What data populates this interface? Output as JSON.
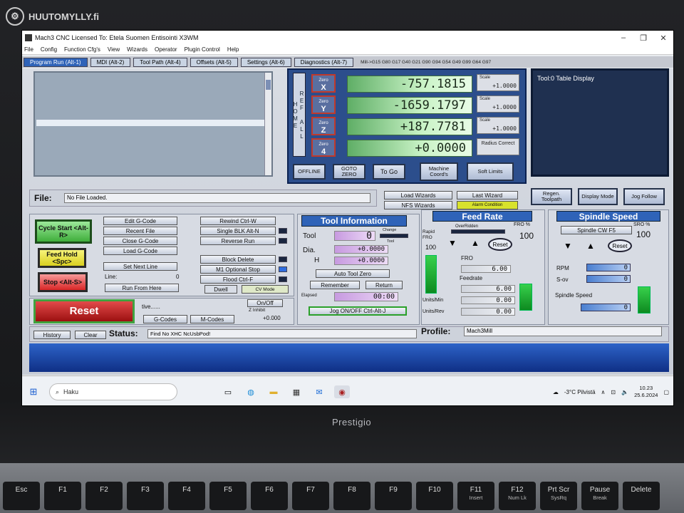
{
  "watermark": "HUUTOMYLLY.fi",
  "window": {
    "title": "Mach3 CNC  Licensed To: Etela Suomen Entisointi X3WM"
  },
  "menu": [
    "File",
    "Config",
    "Function Cfg's",
    "View",
    "Wizards",
    "Operator",
    "Plugin Control",
    "Help"
  ],
  "tabs": [
    "Program Run (Alt-1)",
    "MDI (Alt-2)",
    "Tool Path (Alt-4)",
    "Offsets (Alt-5)",
    "Settings (Alt-6)",
    "Diagnostics (Alt-7)"
  ],
  "active_gcodes": "Mill->G15  G80 G17 G40 G21 G90 G94 G54 G49 G99 G64 G97",
  "dro": {
    "ref_all_home": "REF ALL HOME",
    "axes": [
      {
        "zero_label": "Zero",
        "axis": "X",
        "value": "-757.1815",
        "scale_label": "Scale",
        "scale": "+1.0000"
      },
      {
        "zero_label": "Zero",
        "axis": "Y",
        "value": "-1659.1797",
        "scale_label": "Scale",
        "scale": "+1.0000"
      },
      {
        "zero_label": "Zero",
        "axis": "Z",
        "value": "+187.7781",
        "scale_label": "Scale",
        "scale": "+1.0000"
      },
      {
        "zero_label": "Zero",
        "axis": "4",
        "value": "+0.0000",
        "radius_label": "Radius Correct"
      }
    ],
    "buttons": [
      "OFFLINE",
      "GOTO ZERO",
      "To Go",
      "Machine Coord's",
      "Soft Limits"
    ]
  },
  "tool_display": {
    "label": "Tool:0   Table Display"
  },
  "file": {
    "label": "File:",
    "value": "No File Loaded."
  },
  "wizards": {
    "load": "Load Wizards",
    "last": "Last Wizard",
    "nfs": "NFS Wizards",
    "alarm": "Alarm Condition"
  },
  "view_buttons": [
    "Regen. Toolpath",
    "Display Mode",
    "Jog Follow"
  ],
  "program": {
    "cycle_start": "Cycle Start <Alt-R>",
    "feed_hold": "Feed Hold <Spc>",
    "stop": "Stop <Alt-S>",
    "reset": "Reset",
    "edit": "Edit G-Code",
    "recent": "Recent File",
    "close": "Close G-Code",
    "load": "Load G-Code",
    "set_next": "Set Next Line",
    "line_label": "Line:",
    "line_value": "0",
    "run_from": "Run From Here",
    "rewind": "Rewind Ctrl-W",
    "single_blk": "Single BLK Alt-N",
    "reverse": "Reverse Run",
    "block_delete": "Block Delete",
    "m1_stop": "M1 Optional Stop",
    "flood": "Flood Ctrl-F",
    "dwell": "Dwell",
    "cv_mode": "CV Mode",
    "tive": "tive......",
    "onoff": "On/Off",
    "z_inhibit": "Z Inhibit",
    "z_value": "+0.000",
    "gcodes_btn": "G-Codes",
    "mcodes_btn": "M-Codes"
  },
  "tool_info": {
    "title": "Tool Information",
    "tool_label": "Tool",
    "tool_value": "0",
    "change_label": "Change",
    "tool_small": "Tool",
    "dia_label": "Dia.",
    "dia_value": "+0.0000",
    "h_label": "H",
    "h_value": "+0.0000",
    "auto_zero": "Auto Tool Zero",
    "remember": "Remember",
    "return": "Return",
    "elapsed_label": "Elapsed",
    "elapsed_value": "00:00",
    "jog": "Jog ON/OFF Ctrl-Alt-J"
  },
  "feed": {
    "title": "Feed Rate",
    "overridden": "OverRidden",
    "fro_pct_label": "FRO %",
    "fro_pct": "100",
    "rapid_label": "Rapid FRO",
    "rapid_value": "100",
    "reset": "Reset",
    "fro_label": "FRO",
    "fro_value": "6.00",
    "feedrate_label": "Feedrate",
    "feedrate_value": "6.00",
    "upm_label": "Units/Min",
    "upm_value": "0.00",
    "upr_label": "Units/Rev",
    "upr_value": "0.00",
    "rapid_fill": 1.0,
    "fro_fill": 0.7
  },
  "spindle": {
    "title": "Spindle Speed",
    "cw": "Spindle CW F5",
    "sro_label": "SRO %",
    "sro_value": "100",
    "reset": "Reset",
    "rpm_label": "RPM",
    "rpm_value": "0",
    "sov_label": "S-ov",
    "sov_value": "0",
    "speed_label": "Spindle Speed",
    "speed_value": "0",
    "sro_fill": 0.7
  },
  "status": {
    "history": "History",
    "clear": "Clear",
    "status_label": "Status:",
    "status_value": "Find No XHC NcUsbPod!",
    "profile_label": "Profile:",
    "profile_value": "Mach3Mill"
  },
  "taskbar": {
    "search": "Haku",
    "weather": "-3°C  Pilvistä",
    "time": "10.23",
    "date": "25.6.2024"
  },
  "laptop_brand": "Prestigio",
  "keys": [
    {
      "main": "Esc",
      "sub": ""
    },
    {
      "main": "F1",
      "sub": ""
    },
    {
      "main": "F2",
      "sub": ""
    },
    {
      "main": "F3",
      "sub": ""
    },
    {
      "main": "F4",
      "sub": ""
    },
    {
      "main": "F5",
      "sub": ""
    },
    {
      "main": "F6",
      "sub": ""
    },
    {
      "main": "F7",
      "sub": ""
    },
    {
      "main": "F8",
      "sub": ""
    },
    {
      "main": "F9",
      "sub": ""
    },
    {
      "main": "F10",
      "sub": ""
    },
    {
      "main": "F11",
      "sub": "Insert"
    },
    {
      "main": "F12",
      "sub": "Num Lk"
    },
    {
      "main": "Prt Scr",
      "sub": "SysRq"
    },
    {
      "main": "Pause",
      "sub": "Break"
    },
    {
      "main": "Delete",
      "sub": ""
    }
  ]
}
